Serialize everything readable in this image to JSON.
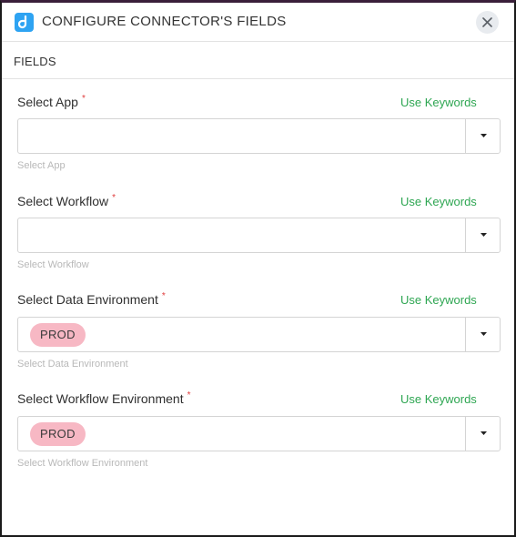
{
  "dialog": {
    "title": "CONFIGURE CONNECTOR'S FIELDS",
    "section_label": "FIELDS",
    "logo_icon": "connector-logo-icon",
    "close_icon": "close-icon"
  },
  "colors": {
    "accent_link": "#2ea652",
    "required_star": "#e03d3d",
    "tag_bg": "#f7b8c4",
    "logo_bg": "#2ea3f2"
  },
  "fields": [
    {
      "label": "Select App",
      "required": "*",
      "keywords_link": "Use Keywords",
      "value": "",
      "hint": "Select App"
    },
    {
      "label": "Select Workflow",
      "required": "*",
      "keywords_link": "Use Keywords",
      "value": "",
      "hint": "Select Workflow"
    },
    {
      "label": "Select Data Environment",
      "required": "*",
      "keywords_link": "Use Keywords",
      "value": "PROD",
      "hint": "Select Data Environment"
    },
    {
      "label": "Select Workflow Environment",
      "required": "*",
      "keywords_link": "Use Keywords",
      "value": "PROD",
      "hint": "Select Workflow Environment"
    }
  ]
}
